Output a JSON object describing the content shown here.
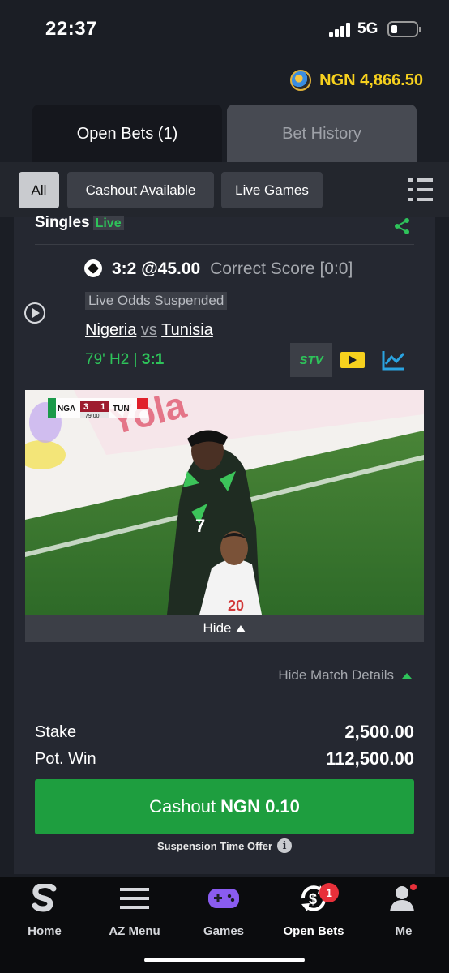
{
  "status_bar": {
    "time": "22:37",
    "network": "5G"
  },
  "header": {
    "balance": "NGN 4,866.50"
  },
  "tabs": [
    {
      "label": "Open Bets (1)",
      "active": true
    },
    {
      "label": "Bet History",
      "active": false
    }
  ],
  "filters": [
    {
      "label": "All",
      "active": true
    },
    {
      "label": "Cashout Available",
      "active": false
    },
    {
      "label": "Live Games",
      "active": false
    }
  ],
  "bet": {
    "type_label": "Singles",
    "live_label": "Live",
    "selection": "3:2",
    "odds": "@45.00",
    "market": "Correct Score [0:0]",
    "status": "Live Odds Suspended",
    "home_team": "Nigeria",
    "vs": "vs",
    "away_team": "Tunisia",
    "match_time": "79' H2 |",
    "current_score": "3:1",
    "stv_label": "STV"
  },
  "video": {
    "home_code": "NGA",
    "home_score": "3",
    "away_score": "1",
    "away_code": "TUN",
    "clock": "79:00",
    "shirt_number_home": "7",
    "shirt_number_away": "20",
    "hide_label": "Hide"
  },
  "details": {
    "toggle_label": "Hide Match Details",
    "stake_label": "Stake",
    "stake_value": "2,500.00",
    "potwin_label": "Pot. Win",
    "potwin_value": "112,500.00",
    "cashout_prefix": "Cashout",
    "cashout_amount": "NGN 0.10",
    "suspension_note": "Suspension Time Offer"
  },
  "nav": [
    {
      "label": "Home",
      "icon": "sportybet-logo-icon"
    },
    {
      "label": "AZ Menu",
      "icon": "hamburger-menu-icon"
    },
    {
      "label": "Games",
      "icon": "gamepad-icon"
    },
    {
      "label": "Open Bets",
      "icon": "cashout-icon",
      "badge": "1",
      "active": true
    },
    {
      "label": "Me",
      "icon": "user-icon"
    }
  ],
  "colors": {
    "background": "#1b1e25",
    "accent_green": "#2ec35a",
    "cashout_green": "#1e9e3f",
    "balance_yellow": "#f7d11e",
    "badge_red": "#e8303a",
    "stats_blue": "#2aa3e0"
  }
}
